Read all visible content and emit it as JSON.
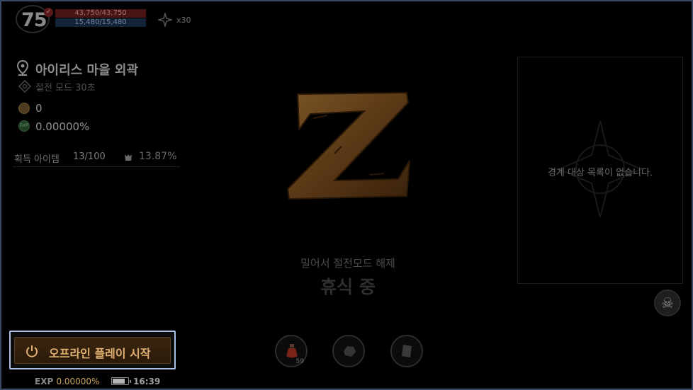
{
  "hud": {
    "level": "75",
    "level_badge": "✓",
    "hp_text": "43,750/43,750",
    "mp_text": "15,480/15,480",
    "kill_count": "x30"
  },
  "location": {
    "name": "아이리스 마을 외곽",
    "mode": "절전 모드  30초"
  },
  "currency": {
    "coin": "0",
    "exp": "0.00000%"
  },
  "items": {
    "label": "획득 아이템",
    "count": "13/100",
    "weight": "13.87%"
  },
  "center": {
    "swipe_hint": "밀어서 절전모드 해제",
    "status": "휴식 중"
  },
  "guard": {
    "empty_text": "경계 대상 목록이 없습니다."
  },
  "slots": {
    "potion_count": "59"
  },
  "offline": {
    "label": "오프라인 플레이 시작"
  },
  "footer": {
    "exp_label": "EXP",
    "exp_value": "0.00000%",
    "battery_level": 0.8,
    "time": "16:39"
  },
  "colors": {
    "accent_gold": "#e0b070",
    "highlight_border": "#a9bfe6",
    "hp": "#4a1414",
    "mp": "#142438"
  },
  "icons": {
    "location": "map-pin-icon",
    "mode": "power-save-icon",
    "coin": "coin-icon",
    "exp": "exp-orb-icon",
    "weight": "weight-icon",
    "kill": "crosshair-icon",
    "skull": "skull-icon",
    "power": "power-icon"
  }
}
